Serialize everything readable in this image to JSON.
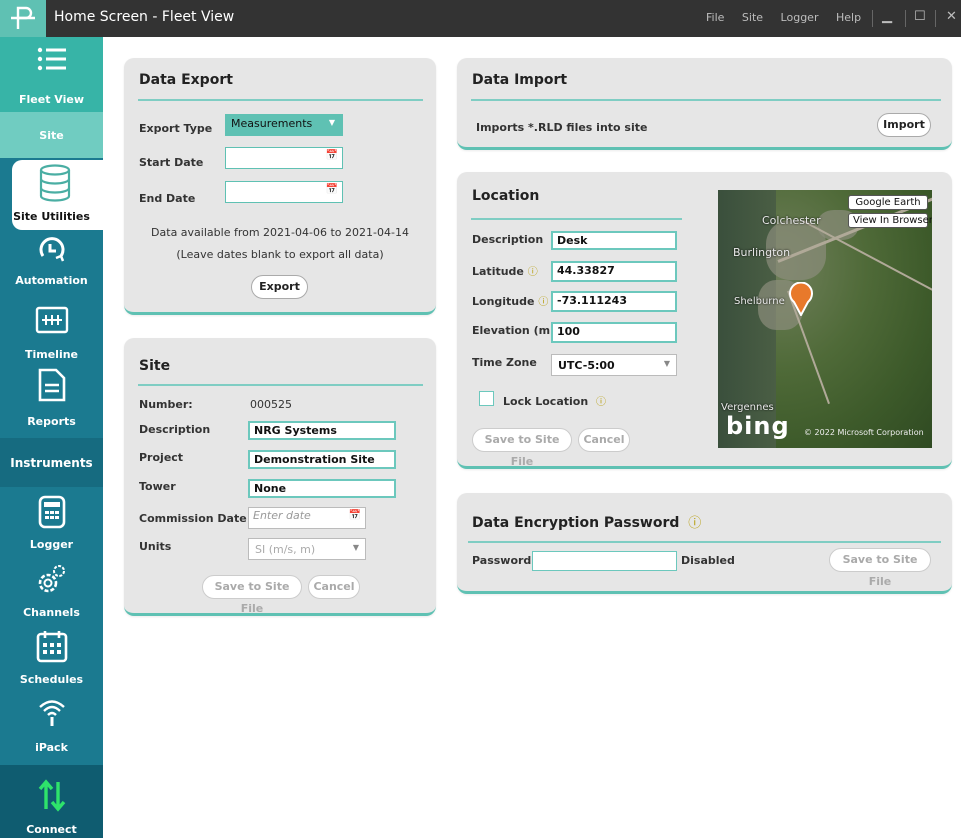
{
  "window": {
    "title": "Home Screen - Fleet View",
    "menu": [
      "File",
      "Site",
      "Logger",
      "Help"
    ],
    "minimize": "▁",
    "maximize": "☐",
    "close": "✕"
  },
  "sidebar": {
    "fleet_view": "Fleet View",
    "site": "Site",
    "site_utilities": "Site Utilities",
    "automation": "Automation",
    "timeline": "Timeline",
    "reports": "Reports",
    "instruments": "Instruments",
    "logger": "Logger",
    "channels": "Channels",
    "schedules": "Schedules",
    "ipack": "iPack",
    "connect": "Connect"
  },
  "data_export": {
    "title": "Data Export",
    "export_type_label": "Export Type",
    "export_type_value": "Measurements",
    "start_date_label": "Start Date",
    "end_date_label": "End Date",
    "availability": "Data available from 2021-04-06 to 2021-04-14",
    "hint": "(Leave dates blank to export all data)",
    "export_button": "Export"
  },
  "data_import": {
    "title": "Data Import",
    "description": "Imports *.RLD files into site",
    "import_button": "Import"
  },
  "site": {
    "title": "Site",
    "number_label": "Number:",
    "number_value": "000525",
    "description_label": "Description",
    "description_value": "NRG Systems",
    "project_label": "Project",
    "project_value": "Demonstration Site",
    "tower_label": "Tower",
    "tower_value": "None",
    "commission_label": "Commission Date",
    "commission_placeholder": "Enter date",
    "units_label": "Units",
    "units_value": "SI (m/s, m)",
    "save_button": "Save to Site File",
    "cancel_button": "Cancel"
  },
  "location": {
    "title": "Location",
    "description_label": "Description",
    "description_value": "Desk",
    "latitude_label": "Latitude",
    "latitude_value": "44.33827",
    "longitude_label": "Longitude",
    "longitude_value": "-73.111243",
    "elevation_label": "Elevation (m)",
    "elevation_value": "100",
    "timezone_label": "Time Zone",
    "timezone_value": "UTC-5:00",
    "lock_label": "Lock Location",
    "save_button": "Save to Site File",
    "cancel_button": "Cancel",
    "map": {
      "google_earth": "Google Earth",
      "view_in_browser": "View In Browser",
      "places": [
        "Colchester",
        "Burlington",
        "Shelburne",
        "Vergennes"
      ],
      "bing": "bing",
      "copyright": "© 2022 Microsoft Corporation"
    }
  },
  "encryption": {
    "title": "Data Encryption Password",
    "password_label": "Password",
    "password_value": "",
    "status": "Disabled",
    "save_button": "Save to Site File"
  },
  "colors": {
    "accent": "#5fc1b3",
    "sidebar": "#1b7a90",
    "titlebar": "#333333",
    "info": "#b49a00"
  }
}
